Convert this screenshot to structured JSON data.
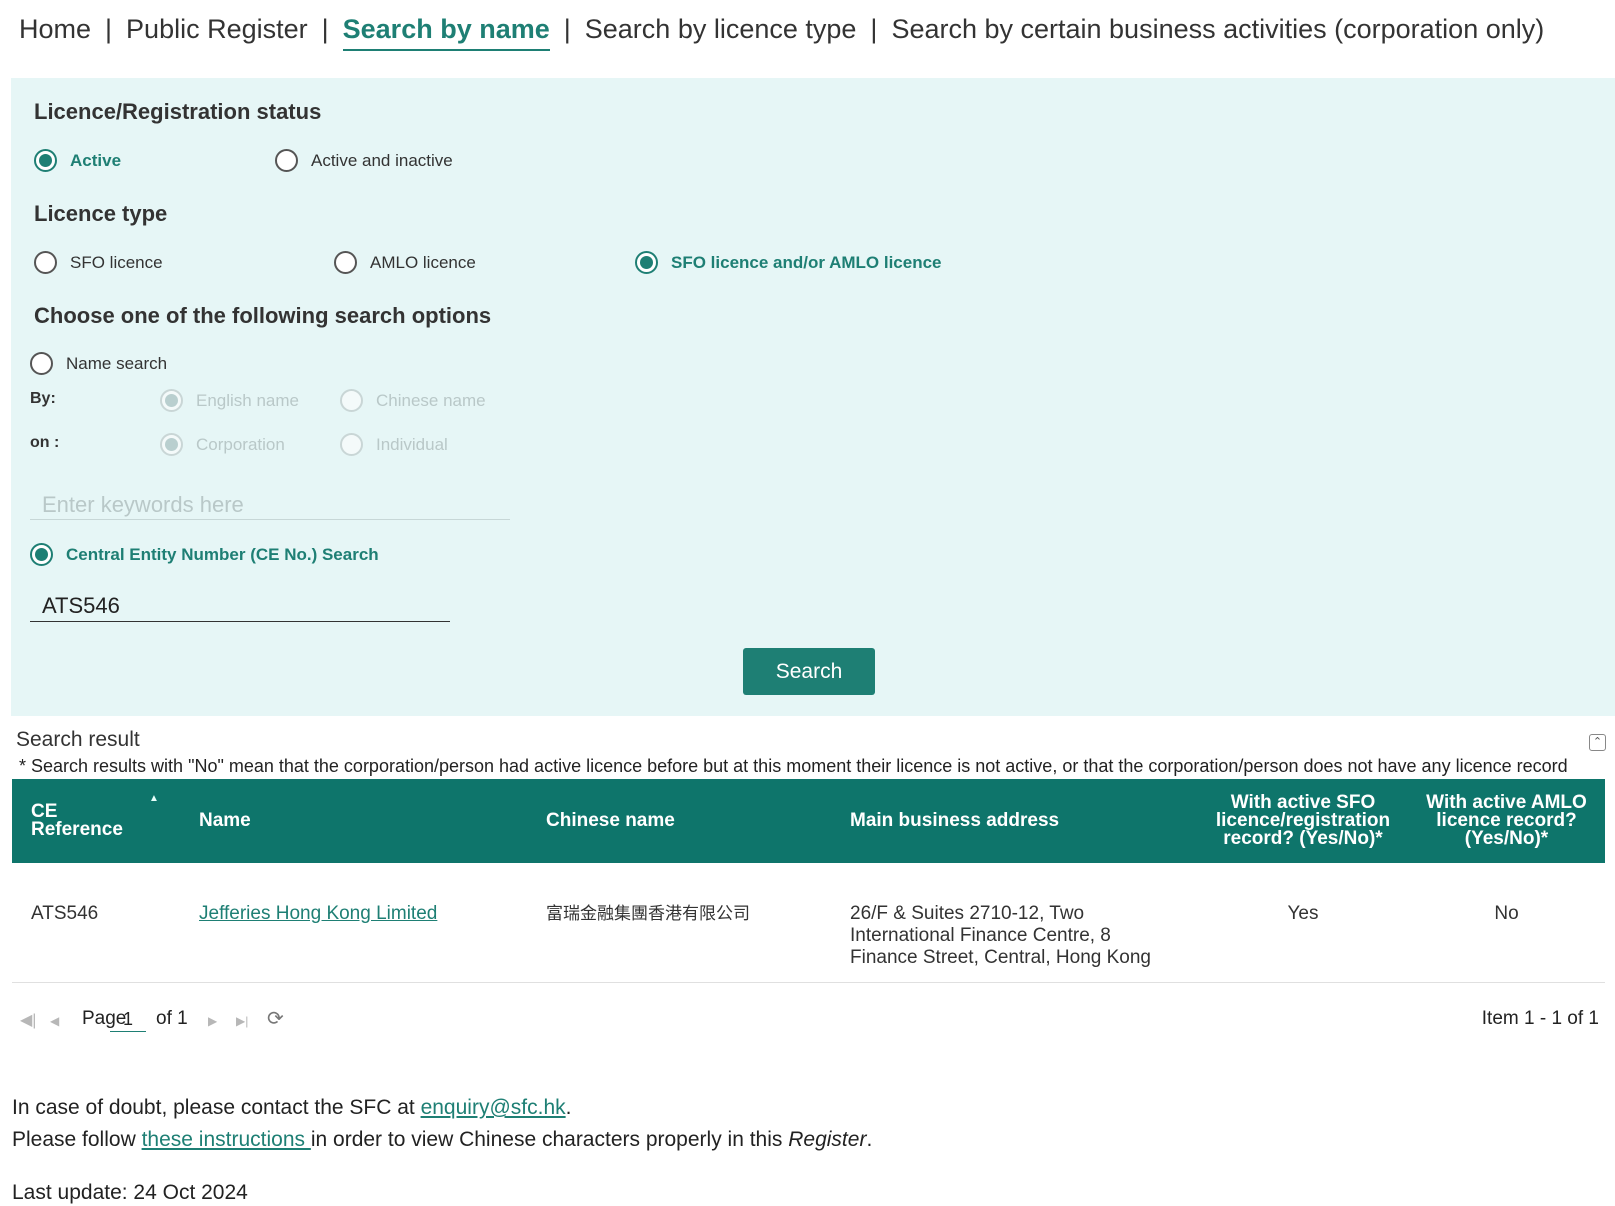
{
  "nav": {
    "home": "Home",
    "public_register": "Public Register",
    "search_by_name": "Search by name",
    "search_by_licence_type": "Search by licence type",
    "search_by_activities": "Search by certain business activities (corporation only)",
    "separator": "|"
  },
  "form": {
    "status_heading": "Licence/Registration status",
    "status_active": "Active",
    "status_active_inactive": "Active and inactive",
    "type_heading": "Licence type",
    "type_sfo": "SFO licence",
    "type_amlo": "AMLO licence",
    "type_both": "SFO licence and/or AMLO licence",
    "options_heading": "Choose one of the following search options",
    "name_search": "Name search",
    "by_label": "By:",
    "by_english": "English name",
    "by_chinese": "Chinese name",
    "on_label": "on :",
    "on_corporation": "Corporation",
    "on_individual": "Individual",
    "keyword_placeholder": "Enter keywords here",
    "ce_search": "Central Entity Number (CE No.) Search",
    "ce_value": "ATS546",
    "search_button": "Search"
  },
  "results": {
    "title": "Search result",
    "note": "* Search results with \"No\" mean that the corporation/person had active licence before but at this moment their licence is not active, or that the corporation/person does not have any licence record",
    "columns": {
      "ce_line1": "CE",
      "ce_line2": "Reference",
      "name": "Name",
      "chinese_name": "Chinese name",
      "address": "Main business address",
      "sfo_line1": "With active SFO",
      "sfo_line2": "licence/registration",
      "sfo_line3": "record? (Yes/No)*",
      "amlo_line1": "With active AMLO",
      "amlo_line2": "licence record?",
      "amlo_line3": "(Yes/No)*"
    },
    "rows": [
      {
        "ce": "ATS546",
        "name": "Jefferies Hong Kong Limited",
        "chinese_name": "富瑞金融集團香港有限公司",
        "address_line1": "26/F & Suites 2710-12, Two",
        "address_line2": "International Finance Centre, 8",
        "address_line3": "Finance Street, Central, Hong Kong",
        "sfo": "Yes",
        "amlo": "No"
      }
    ],
    "pager": {
      "page_label": "Page",
      "page_value": "1",
      "of_label": "of 1",
      "item_count": "Item 1 - 1 of 1"
    }
  },
  "footer": {
    "doubt_prefix": "In case of doubt, please contact the SFC at ",
    "email": "enquiry@sfc.hk",
    "doubt_suffix": ".",
    "follow_prefix": "Please follow ",
    "instructions_link": "these instructions ",
    "follow_middle": "in order to view Chinese characters properly in this ",
    "register_word": "Register",
    "follow_suffix": ".",
    "last_update": "Last update: 24 Oct 2024"
  },
  "icons": {
    "first": "first-page-icon",
    "prev": "prev-page-icon",
    "next": "next-page-icon",
    "last": "last-page-icon",
    "refresh": "refresh-icon",
    "collapse": "collapse-icon"
  },
  "colors": {
    "accent": "#1e7f74",
    "header_bg": "#0e756b",
    "panel_bg": "#e6f6f6"
  }
}
